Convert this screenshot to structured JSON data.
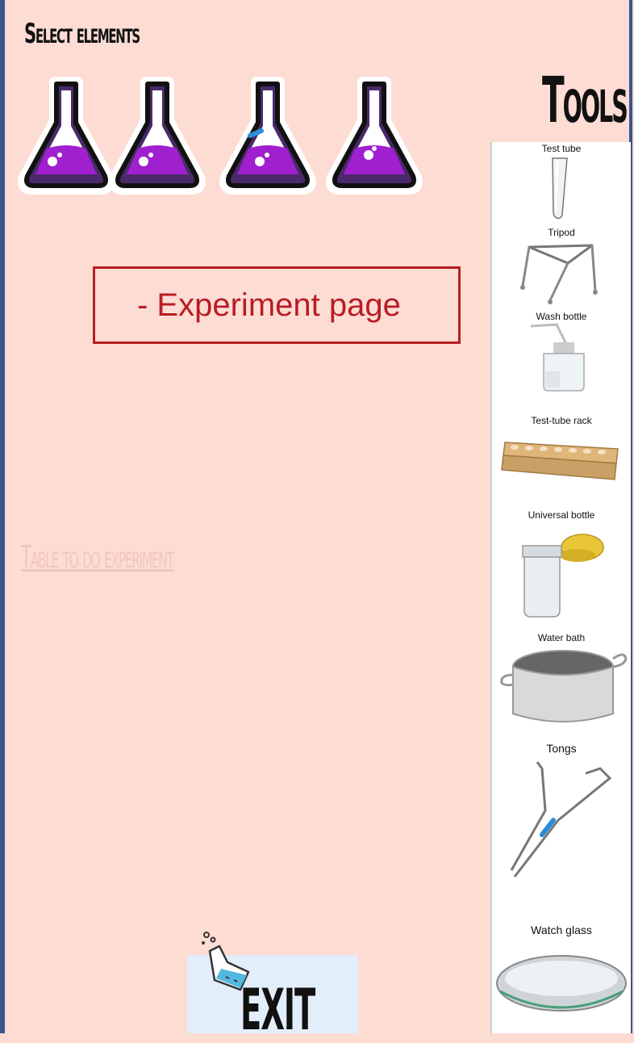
{
  "header": {
    "select_title": "Select elements",
    "tools_title": "Tools"
  },
  "main": {
    "experiment_label": "- Experiment page",
    "table_link": "Table to do experiment"
  },
  "flasks": [
    "flask-icon",
    "flask-icon",
    "flask-icon",
    "flask-icon"
  ],
  "tools": [
    {
      "label": "Test tube",
      "icon": "test-tube-icon"
    },
    {
      "label": "Tripod",
      "icon": "tripod-icon"
    },
    {
      "label": "Wash bottle",
      "icon": "wash-bottle-icon"
    },
    {
      "label": "Test-tube rack",
      "icon": "test-tube-rack-icon"
    },
    {
      "label": "Universal bottle",
      "icon": "universal-bottle-icon"
    },
    {
      "label": "Water bath",
      "icon": "water-bath-icon"
    },
    {
      "label": "Tongs",
      "icon": "tongs-icon"
    },
    {
      "label": "Watch glass",
      "icon": "watch-glass-icon"
    }
  ],
  "exit": {
    "label": "EXIT",
    "icon": "spilled-flask-icon"
  },
  "colors": {
    "background": "#fddcd4",
    "accent_red": "#b81d24",
    "flask_purple": "#a020d0",
    "frame_blue": "#3a5590"
  }
}
